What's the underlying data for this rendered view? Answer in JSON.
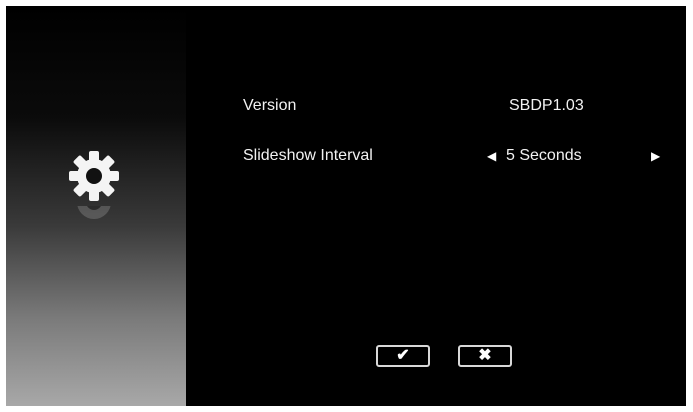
{
  "settings": {
    "rows": [
      {
        "label": "Version",
        "value": "SBDP1.03"
      },
      {
        "label": "Slideshow Interval",
        "value": "5 Seconds"
      }
    ]
  },
  "icons": {
    "sidebar": "gear-icon",
    "prev": "left-triangle-icon",
    "next": "right-triangle-icon",
    "confirm": "checkmark-icon",
    "cancel": "x-icon"
  },
  "glyphs": {
    "prev": "◀",
    "next": "▶",
    "confirm": "✔",
    "cancel": "✖"
  },
  "colors": {
    "background": "#000000",
    "text": "#f2f2f2",
    "button_border": "#d8d8d8"
  }
}
